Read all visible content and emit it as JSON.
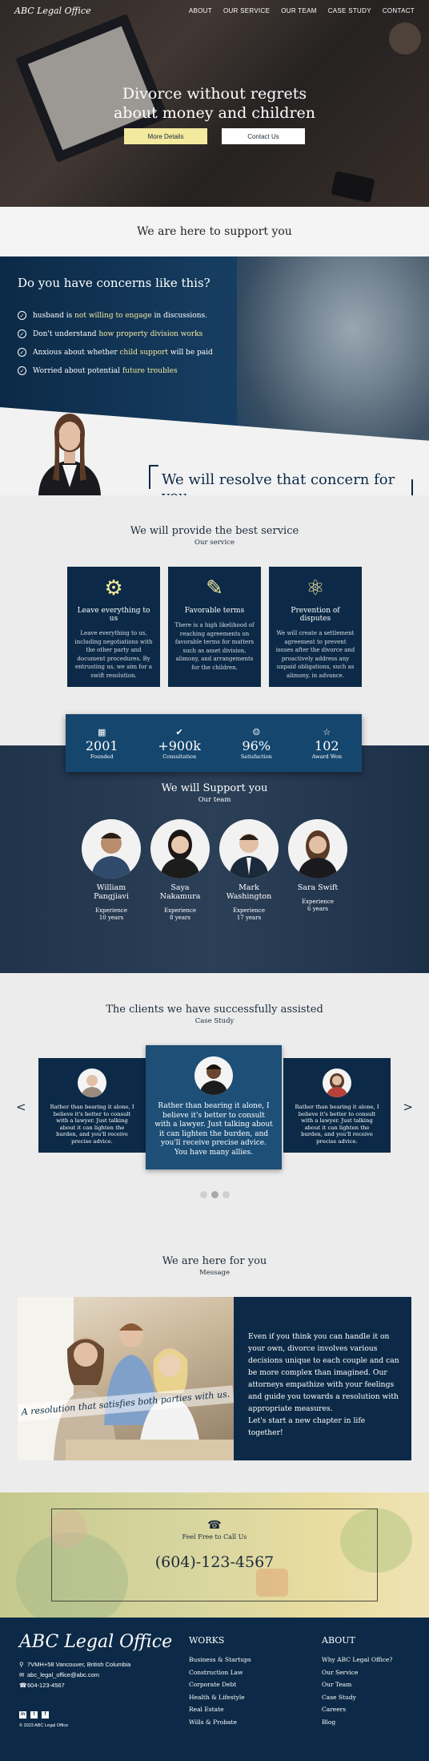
{
  "header": {
    "logo": "ABC Legal Office",
    "nav": [
      "ABOUT",
      "OUR SERVICE",
      "OUR TEAM",
      "CASE STUDY",
      "CONTACT"
    ]
  },
  "hero": {
    "line1": "Divorce without regrets",
    "line2": "about money and children",
    "btn_more": "More Details",
    "btn_contact": "Contact Us"
  },
  "support_strip": "We are here to support you",
  "concerns": {
    "title": "Do you have concerns like this?",
    "items": [
      {
        "pre": "husband is ",
        "hl": "not willing to engage",
        "post": " in discussions."
      },
      {
        "pre": "Don't understand ",
        "hl": "how property division works",
        "post": ""
      },
      {
        "pre": "Anxious about whether ",
        "hl": "child support",
        "post": " will be paid"
      },
      {
        "pre": "Worried about potential ",
        "hl": "future troubles",
        "post": ""
      }
    ],
    "resolve": "We will resolve that concern for you"
  },
  "services": {
    "title": "We will provide the best service",
    "subtitle": "Our service",
    "cards": [
      {
        "title": "Leave everything to us",
        "icon": "team-icon",
        "text": "Leave everything to us, including negotiations with the other party and document procedures. By entrusting us, we aim for a swift resolution."
      },
      {
        "title": "Favorable terms",
        "icon": "document-icon",
        "text": "There is a high likelihood of reaching agreements on favorable terms for matters such as asset division, alimony, and arrangements for the children."
      },
      {
        "title": "Prevention of disputes",
        "icon": "people-network-icon",
        "text": "We will create a settlement agreement to prevent issues after the divorce and proactively address any unpaid obligations, such as alimony, in advance."
      }
    ]
  },
  "stats": [
    {
      "icon": "building-icon",
      "value": "2001",
      "label": "Founded"
    },
    {
      "icon": "check-circle-icon",
      "value": "+900k",
      "label": "Consultation"
    },
    {
      "icon": "smile-icon",
      "value": "96%",
      "label": "Satisfaction"
    },
    {
      "icon": "award-icon",
      "value": "102",
      "label": "Award Won"
    }
  ],
  "team": {
    "title": "We will Support you",
    "subtitle": "Our team",
    "members": [
      {
        "name": "William Pangjiavi",
        "exp_label": "Experience",
        "exp": "10 years"
      },
      {
        "name": "Saya Nakamura",
        "exp_label": "Experience",
        "exp": "8 years"
      },
      {
        "name": "Mark Washington",
        "exp_label": "Experience",
        "exp": "17 years"
      },
      {
        "name": "Sara Swift",
        "exp_label": "Experience",
        "exp": "6 years"
      }
    ]
  },
  "cases": {
    "title": "The clients we have successfully assisted",
    "subtitle": "Case Study",
    "left_text": "Rather than bearing it alone, I believe it's better to consult with a lawyer. Just talking about it can lighten the burden, and you'll receive precise advice.",
    "mid_text": "Rather than bearing it alone, I believe it's better to consult with a lawyer. Just talking about it can lighten the burden, and you'll receive precise advice. You have many allies.",
    "right_text": "Rather than bearing it alone, I believe it's better to consult with a lawyer. Just talking about it can lighten the burden, and you'll receive precise advice.",
    "prev": "<",
    "next": ">"
  },
  "message": {
    "title": "We are here for you",
    "subtitle": "Message",
    "banner": "A resolution that satisfies both parties with us.",
    "text": "Even if you think you can handle it on your own, divorce involves various decisions unique to each couple and can be more complex than imagined. Our attorneys empathize with your feelings and guide you towards a resolution with appropriate measures.",
    "closing": "Let's start a new chapter in life together!"
  },
  "call": {
    "label": "Feel Free to Call Us",
    "phone": "(604)-123-4567"
  },
  "footer": {
    "logo": "ABC Legal Office",
    "address": "7VMH+58 Vancouver, British Columbia",
    "email": "abc_legal_office@abc.com",
    "phone": "604-123-4567",
    "copyright": "© 2023 ABC Legal Office",
    "works_title": "WORKS",
    "works": [
      "Business & Startups",
      "Construction Law",
      "Corporate Debt",
      "Health & Lifestyle",
      "Real Estate",
      "Wills & Probate"
    ],
    "about_title": "ABOUT",
    "about": [
      "Why ABC Legal Office?",
      "Our Service",
      "Our Team",
      "Case Study",
      "Careers",
      "Blog"
    ]
  },
  "colors": {
    "navy": "#0c2a47",
    "accent": "#f3e99f",
    "card_highlight": "#1d4f77"
  }
}
